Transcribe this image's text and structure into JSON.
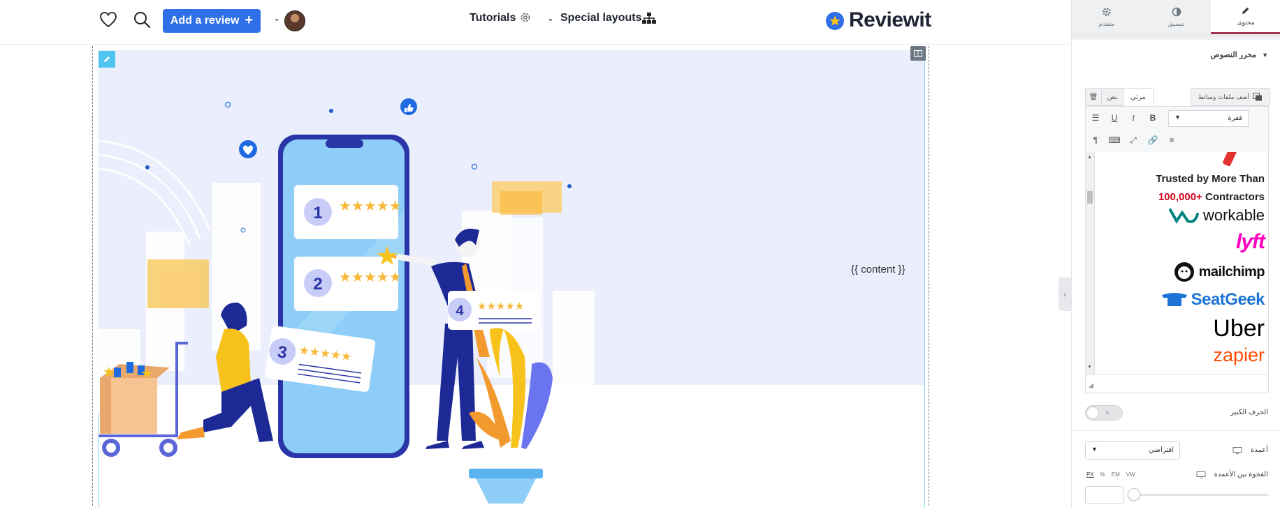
{
  "header": {
    "add_review_label": "Add a review",
    "nav_tutorials": "Tutorials",
    "nav_special_layouts": "Special layouts",
    "logo_text": "Reviewit"
  },
  "canvas": {
    "content_placeholder": "{{ content }}",
    "illustration_numbers": [
      "1",
      "2",
      "3",
      "4"
    ]
  },
  "panel": {
    "tabs": [
      {
        "label": "محتوى",
        "icon": "pencil-icon",
        "active": true
      },
      {
        "label": "تنسيق",
        "icon": "contrast-icon",
        "active": false
      },
      {
        "label": "متقدم",
        "icon": "gear-icon",
        "active": false
      }
    ],
    "section_title": "محرر النصوص",
    "add_media_label": "أضف ملفات وسائط",
    "editor_tabs": {
      "visual": "مرئي",
      "text": "نص"
    },
    "format_select_value": "فقرة",
    "editor_content": {
      "line1": "Trusted by More Than",
      "line2_highlight": "100,000+",
      "line2_rest": "Contractors",
      "logos": [
        "workable",
        "lyft",
        "mailchimp",
        "SeatGeek",
        "Uber",
        "zapier"
      ]
    },
    "drop_cap_label": "الحرف الكبير",
    "drop_cap_toggle_text": "بلا",
    "columns_label": "أعمدة",
    "columns_value": "افتراضي",
    "columns_gap_label": "الفجوة بين الأعمدة",
    "units": [
      "PX",
      "%",
      "EM",
      "VW"
    ]
  },
  "colors": {
    "accent_blue": "#2f6fe8",
    "active_tab_border": "#a4324d",
    "highlight_red": "#d0021b",
    "edit_border": "#7ed2f5"
  }
}
